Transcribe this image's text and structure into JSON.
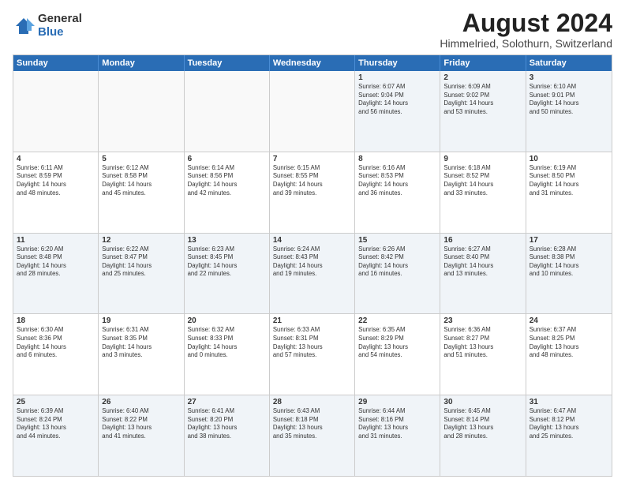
{
  "logo": {
    "general": "General",
    "blue": "Blue"
  },
  "title": "August 2024",
  "subtitle": "Himmelried, Solothurn, Switzerland",
  "header_days": [
    "Sunday",
    "Monday",
    "Tuesday",
    "Wednesday",
    "Thursday",
    "Friday",
    "Saturday"
  ],
  "rows": [
    [
      {
        "day": "",
        "text": ""
      },
      {
        "day": "",
        "text": ""
      },
      {
        "day": "",
        "text": ""
      },
      {
        "day": "",
        "text": ""
      },
      {
        "day": "1",
        "text": "Sunrise: 6:07 AM\nSunset: 9:04 PM\nDaylight: 14 hours\nand 56 minutes."
      },
      {
        "day": "2",
        "text": "Sunrise: 6:09 AM\nSunset: 9:02 PM\nDaylight: 14 hours\nand 53 minutes."
      },
      {
        "day": "3",
        "text": "Sunrise: 6:10 AM\nSunset: 9:01 PM\nDaylight: 14 hours\nand 50 minutes."
      }
    ],
    [
      {
        "day": "4",
        "text": "Sunrise: 6:11 AM\nSunset: 8:59 PM\nDaylight: 14 hours\nand 48 minutes."
      },
      {
        "day": "5",
        "text": "Sunrise: 6:12 AM\nSunset: 8:58 PM\nDaylight: 14 hours\nand 45 minutes."
      },
      {
        "day": "6",
        "text": "Sunrise: 6:14 AM\nSunset: 8:56 PM\nDaylight: 14 hours\nand 42 minutes."
      },
      {
        "day": "7",
        "text": "Sunrise: 6:15 AM\nSunset: 8:55 PM\nDaylight: 14 hours\nand 39 minutes."
      },
      {
        "day": "8",
        "text": "Sunrise: 6:16 AM\nSunset: 8:53 PM\nDaylight: 14 hours\nand 36 minutes."
      },
      {
        "day": "9",
        "text": "Sunrise: 6:18 AM\nSunset: 8:52 PM\nDaylight: 14 hours\nand 33 minutes."
      },
      {
        "day": "10",
        "text": "Sunrise: 6:19 AM\nSunset: 8:50 PM\nDaylight: 14 hours\nand 31 minutes."
      }
    ],
    [
      {
        "day": "11",
        "text": "Sunrise: 6:20 AM\nSunset: 8:48 PM\nDaylight: 14 hours\nand 28 minutes."
      },
      {
        "day": "12",
        "text": "Sunrise: 6:22 AM\nSunset: 8:47 PM\nDaylight: 14 hours\nand 25 minutes."
      },
      {
        "day": "13",
        "text": "Sunrise: 6:23 AM\nSunset: 8:45 PM\nDaylight: 14 hours\nand 22 minutes."
      },
      {
        "day": "14",
        "text": "Sunrise: 6:24 AM\nSunset: 8:43 PM\nDaylight: 14 hours\nand 19 minutes."
      },
      {
        "day": "15",
        "text": "Sunrise: 6:26 AM\nSunset: 8:42 PM\nDaylight: 14 hours\nand 16 minutes."
      },
      {
        "day": "16",
        "text": "Sunrise: 6:27 AM\nSunset: 8:40 PM\nDaylight: 14 hours\nand 13 minutes."
      },
      {
        "day": "17",
        "text": "Sunrise: 6:28 AM\nSunset: 8:38 PM\nDaylight: 14 hours\nand 10 minutes."
      }
    ],
    [
      {
        "day": "18",
        "text": "Sunrise: 6:30 AM\nSunset: 8:36 PM\nDaylight: 14 hours\nand 6 minutes."
      },
      {
        "day": "19",
        "text": "Sunrise: 6:31 AM\nSunset: 8:35 PM\nDaylight: 14 hours\nand 3 minutes."
      },
      {
        "day": "20",
        "text": "Sunrise: 6:32 AM\nSunset: 8:33 PM\nDaylight: 14 hours\nand 0 minutes."
      },
      {
        "day": "21",
        "text": "Sunrise: 6:33 AM\nSunset: 8:31 PM\nDaylight: 13 hours\nand 57 minutes."
      },
      {
        "day": "22",
        "text": "Sunrise: 6:35 AM\nSunset: 8:29 PM\nDaylight: 13 hours\nand 54 minutes."
      },
      {
        "day": "23",
        "text": "Sunrise: 6:36 AM\nSunset: 8:27 PM\nDaylight: 13 hours\nand 51 minutes."
      },
      {
        "day": "24",
        "text": "Sunrise: 6:37 AM\nSunset: 8:25 PM\nDaylight: 13 hours\nand 48 minutes."
      }
    ],
    [
      {
        "day": "25",
        "text": "Sunrise: 6:39 AM\nSunset: 8:24 PM\nDaylight: 13 hours\nand 44 minutes."
      },
      {
        "day": "26",
        "text": "Sunrise: 6:40 AM\nSunset: 8:22 PM\nDaylight: 13 hours\nand 41 minutes."
      },
      {
        "day": "27",
        "text": "Sunrise: 6:41 AM\nSunset: 8:20 PM\nDaylight: 13 hours\nand 38 minutes."
      },
      {
        "day": "28",
        "text": "Sunrise: 6:43 AM\nSunset: 8:18 PM\nDaylight: 13 hours\nand 35 minutes."
      },
      {
        "day": "29",
        "text": "Sunrise: 6:44 AM\nSunset: 8:16 PM\nDaylight: 13 hours\nand 31 minutes."
      },
      {
        "day": "30",
        "text": "Sunrise: 6:45 AM\nSunset: 8:14 PM\nDaylight: 13 hours\nand 28 minutes."
      },
      {
        "day": "31",
        "text": "Sunrise: 6:47 AM\nSunset: 8:12 PM\nDaylight: 13 hours\nand 25 minutes."
      }
    ]
  ]
}
